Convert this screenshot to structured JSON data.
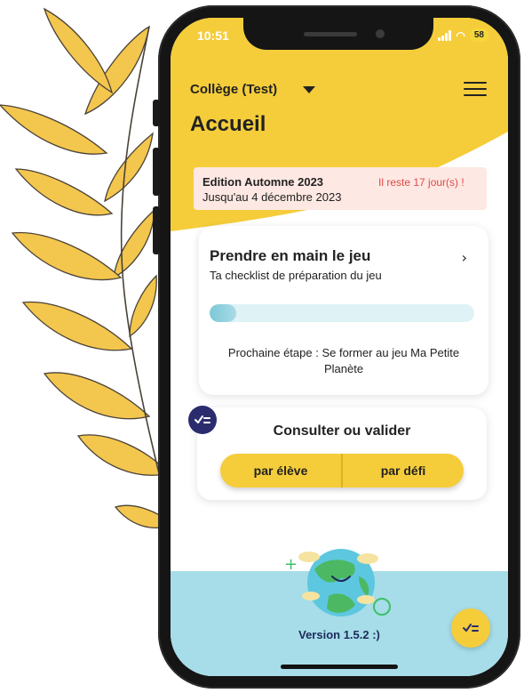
{
  "status_bar": {
    "time": "10:51",
    "battery": "58"
  },
  "header": {
    "school": "Collège (Test)",
    "title": "Accueil"
  },
  "edition_banner": {
    "name": "Edition Automne 2023",
    "until": "Jusqu'au 4 décembre 2023",
    "remaining": "Il reste 17 jour(s) !"
  },
  "checklist_card": {
    "title": "Prendre en main le jeu",
    "subtitle": "Ta checklist de préparation du jeu",
    "progress_fraction": 0.1,
    "next_step": "Prochaine étape : Se former au jeu Ma Petite Planète"
  },
  "validate_card": {
    "title": "Consulter ou valider",
    "buttons": [
      "par élève",
      "par défi"
    ]
  },
  "footer": {
    "version": "Version 1.5.2 :)"
  },
  "colors": {
    "brand_yellow": "#f5cd3b",
    "navy": "#2b2c6e",
    "light_blue": "#a6dde8",
    "alert_red": "#e24a4a",
    "banner_pink": "#fde8e3"
  },
  "icons": {
    "menu": "hamburger-menu-icon",
    "chevron": "chevron-right-icon",
    "checklist": "checklist-icon",
    "globe": "globe-illustration"
  }
}
